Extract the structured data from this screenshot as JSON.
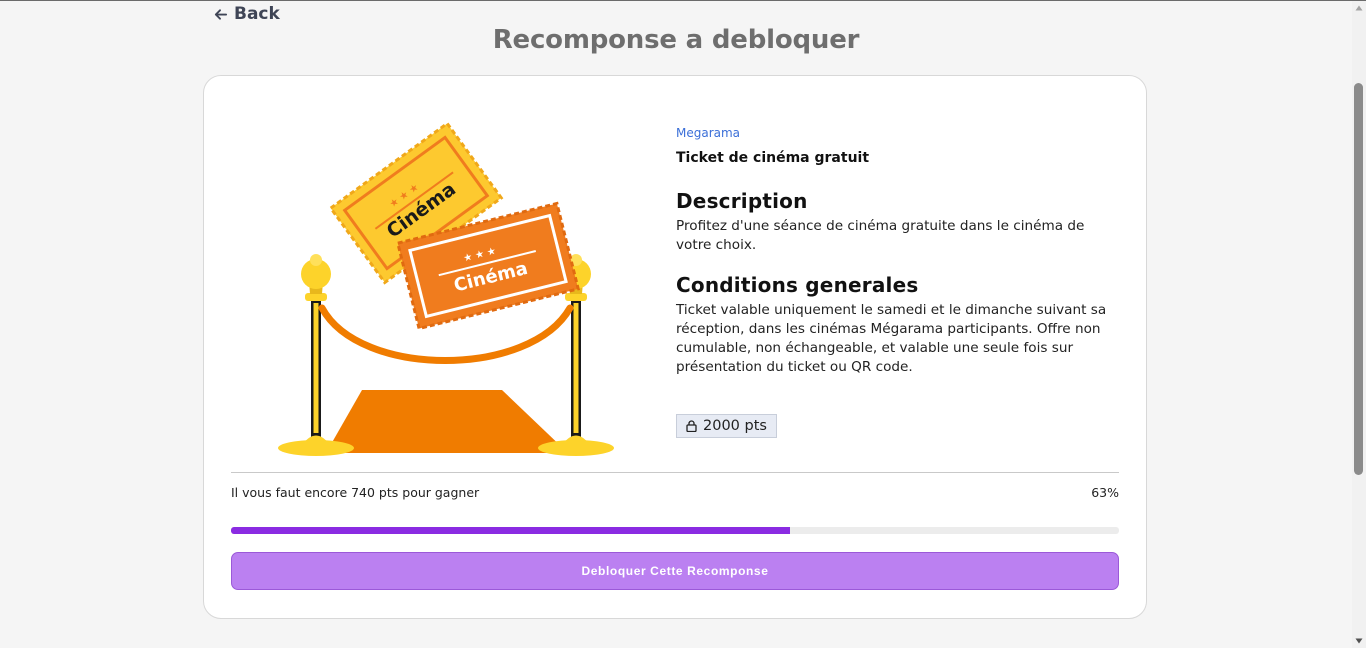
{
  "nav": {
    "back_label": "Back"
  },
  "page": {
    "title": "Recomponse a debloquer"
  },
  "reward": {
    "brand": "Megarama",
    "name": "Ticket de cinéma gratuit",
    "description_heading": "Description",
    "description": "Profitez d'une séance de cinéma gratuite dans le cinéma de votre choix.",
    "conditions_heading": "Conditions generales",
    "conditions": "Ticket valable uniquement le samedi et le dimanche suivant sa réception, dans les cinémas Mégarama participants. Offre non cumulable, non échangeable, et valable une seule fois sur présentation du ticket ou QR code.",
    "points_label": "2000 pts",
    "ticket_text_1": "Cinéma",
    "ticket_text_2": "Cinéma"
  },
  "progress": {
    "message": "Il vous faut encore 740 pts pour gagner",
    "percent_label": "63%",
    "fill_fraction": 0.63
  },
  "actions": {
    "unlock_label": "Debloquer Cette Recomponse"
  },
  "icons": {
    "back": "arrow-left-icon",
    "lock": "lock-icon"
  },
  "colors": {
    "accent": "#8a2be2",
    "button": "#bb80f1",
    "brand_link": "#3b6fd8",
    "ticket_yellow": "#fdc92f",
    "ticket_orange": "#f07c1e"
  }
}
